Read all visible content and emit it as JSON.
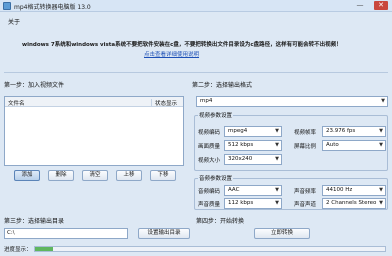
{
  "window": {
    "title": "mp4格式转换器电脑版 13.0",
    "minimize": "—",
    "close": "✕"
  },
  "about": {
    "label": "关于",
    "info": "windows 7系统和windows vista系统不要把软件安装在c盘，不要把转换出文件目录设为c盘路径，这样有可能会转不出视频！",
    "link": "点击查看详细使用说明"
  },
  "step1": {
    "label": "第一步：加入视频文件",
    "columns": [
      "文件名",
      "状态显示"
    ],
    "files": [],
    "buttons": {
      "add": "添加",
      "remove": "删除",
      "clear": "清空",
      "up": "上移",
      "down": "下移"
    }
  },
  "step2": {
    "label": "第二步：选择输出格式",
    "format": "mp4",
    "video": {
      "title": "视频参数设置",
      "codec_label": "视频编码",
      "codec": "mpeg4",
      "fps_label": "视频帧率",
      "fps": "23.976 fps",
      "bitrate_label": "画面质量",
      "bitrate": "512 kbps",
      "aspect_label": "屏幕比例",
      "aspect": "Auto",
      "size_label": "视频大小",
      "size": "320x240"
    },
    "audio": {
      "title": "音频参数设置",
      "codec_label": "音频编码",
      "codec": "AAC",
      "samplerate_label": "声音频率",
      "samplerate": "44100 Hz",
      "bitrate_label": "声音质量",
      "bitrate": "112 kbps",
      "channels_label": "声音声道",
      "channels": "2 Channels Stereo"
    }
  },
  "step3": {
    "label": "第三步：选择输出目录",
    "path": "C:\\",
    "button": "设置输出目录"
  },
  "step4": {
    "label": "第四步：开始转换",
    "button": "立即转换"
  },
  "progress": {
    "label": "进度显示：",
    "value": 0.05
  }
}
